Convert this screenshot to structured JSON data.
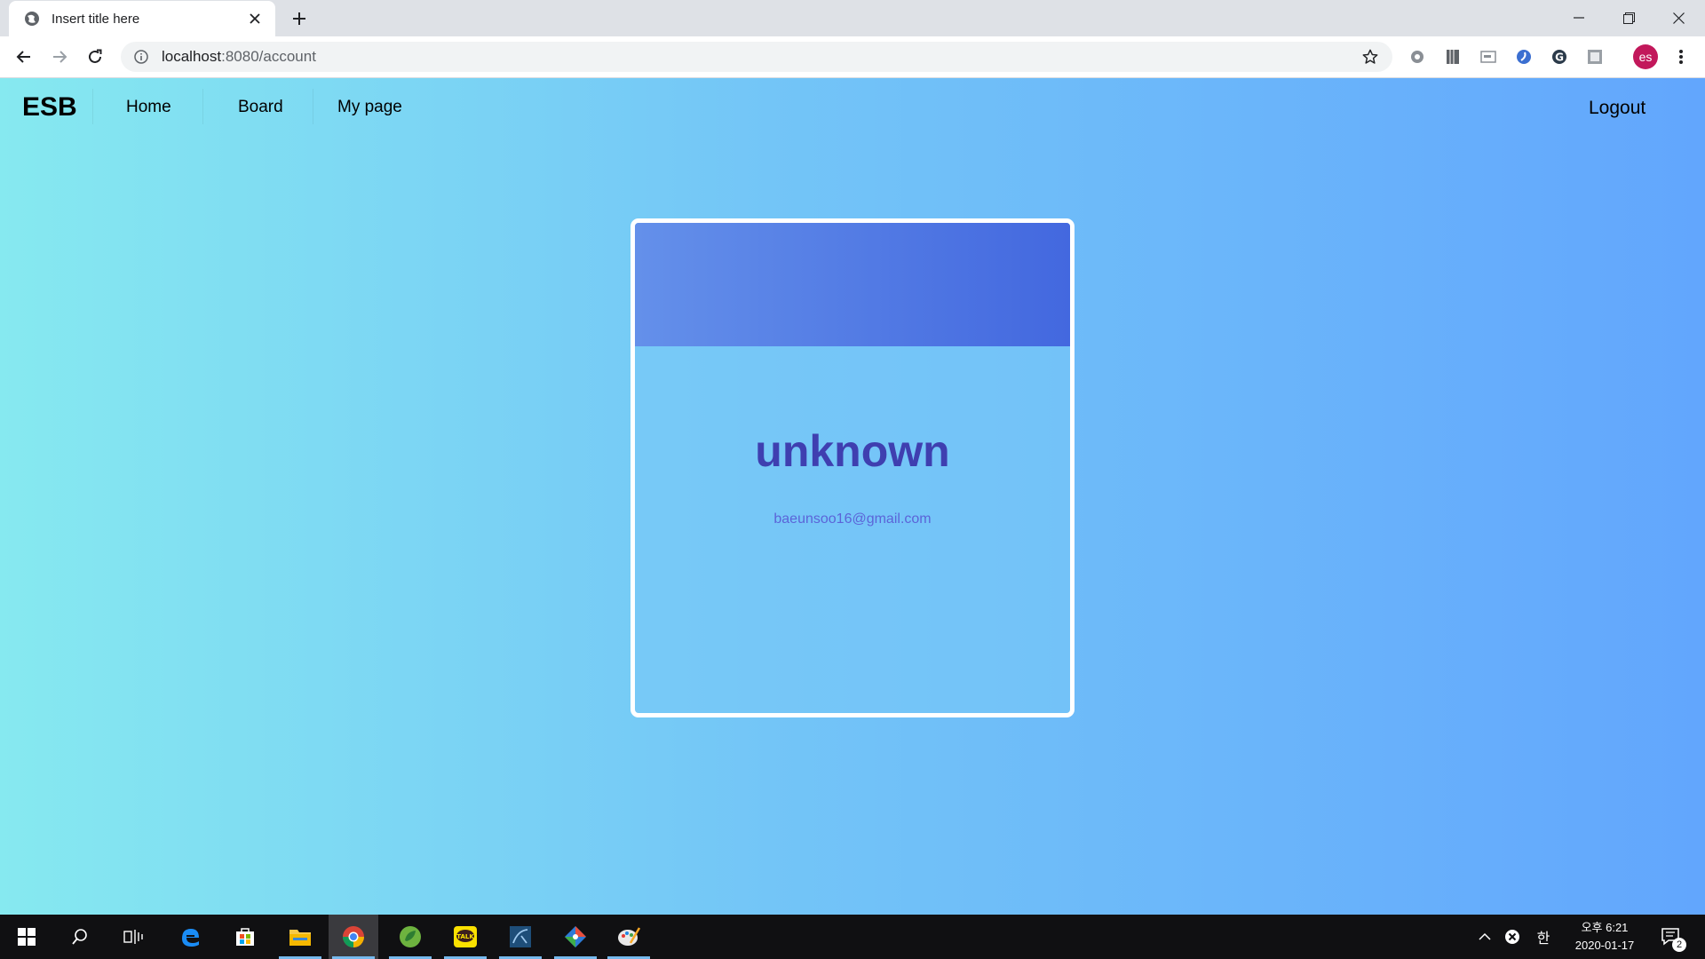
{
  "browser": {
    "tab_title": "Insert title here",
    "url_host": "localhost",
    "url_rest": ":8080/account",
    "profile_initials": "es"
  },
  "site": {
    "brand": "ESB",
    "nav": [
      "Home",
      "Board",
      "My page"
    ],
    "logout": "Logout"
  },
  "profile_card": {
    "name": "unknown",
    "email": "baeunsoo16@gmail.com"
  },
  "taskbar": {
    "tray_ime": "한",
    "clock_period_time": "오후 6:21",
    "clock_date": "2020-01-17",
    "notification_count": "2"
  },
  "colors": {
    "page_gradient_start": "#86e9f0",
    "page_gradient_end": "#62a6fd",
    "card_header_start": "#6490ea",
    "card_header_end": "#4368df",
    "name_color": "#3f3fb0",
    "email_color": "#5b64d8",
    "avatar_bg": "#c2185b"
  }
}
